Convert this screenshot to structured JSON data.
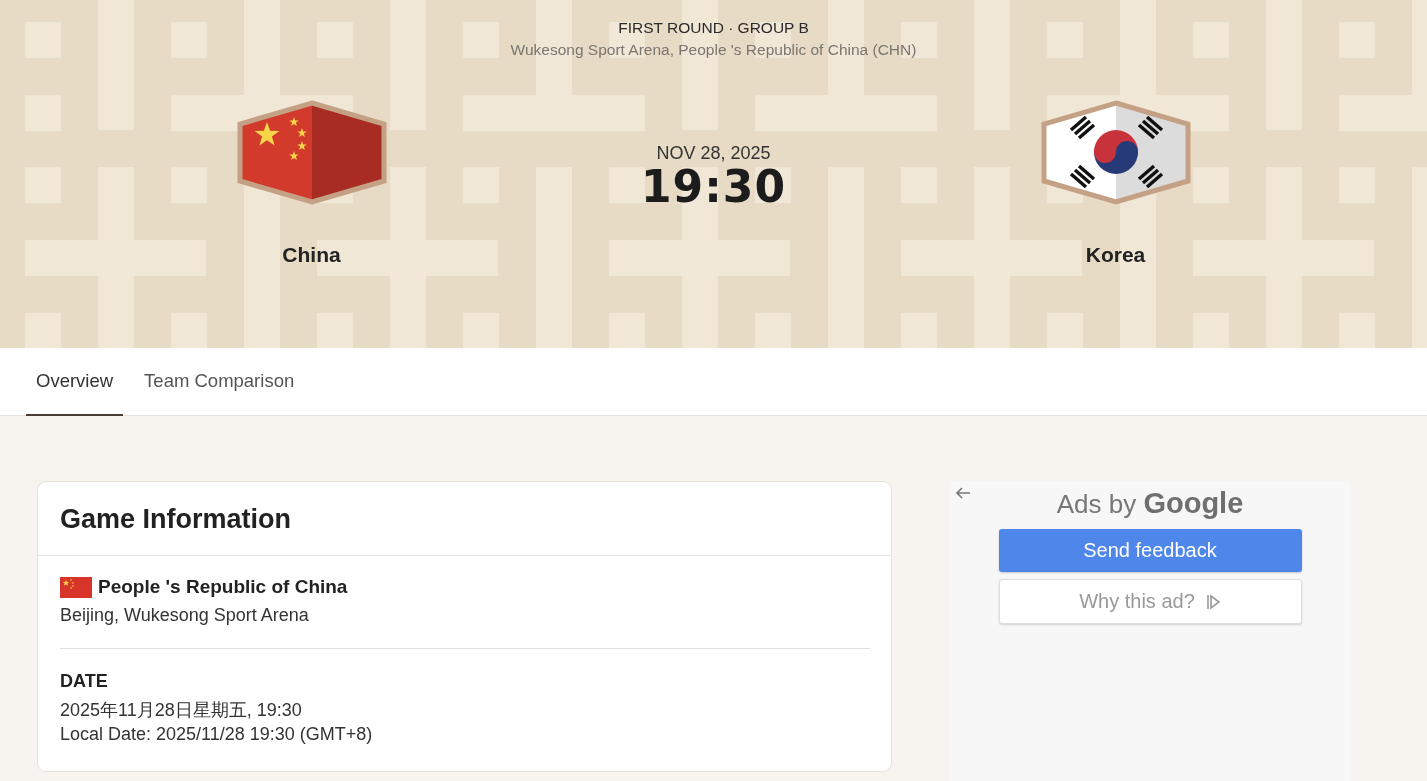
{
  "header": {
    "round": "FIRST ROUND · GROUP B",
    "venue": "Wukesong Sport Arena, People 's Republic of China (CHN)",
    "date": "NOV 28, 2025",
    "time": "19:30",
    "teams": [
      {
        "name": "China",
        "flag": {
          "kind": "china"
        }
      },
      {
        "name": "Korea",
        "flag": {
          "kind": "korea"
        }
      }
    ]
  },
  "tabs": [
    {
      "label": "Overview",
      "selected": true
    },
    {
      "label": "Team Comparison",
      "selected": false
    }
  ],
  "game_info": {
    "title": "Game Information",
    "country": "People 's Republic of China",
    "country_flag": {
      "kind": "china"
    },
    "location": "Beijing, Wukesong Sport Arena",
    "date_label": "DATE",
    "date_lines": [
      "2025年11月28日星期五, 19:30",
      "Local Date: 2025/11/28 19:30 (GMT+8)"
    ]
  },
  "ad": {
    "title": "Ads by **Google**",
    "buttons": [
      {
        "label": "Send feedback",
        "kind": "primary"
      },
      {
        "label": "Why this ad?",
        "kind": "secondary"
      }
    ]
  }
}
